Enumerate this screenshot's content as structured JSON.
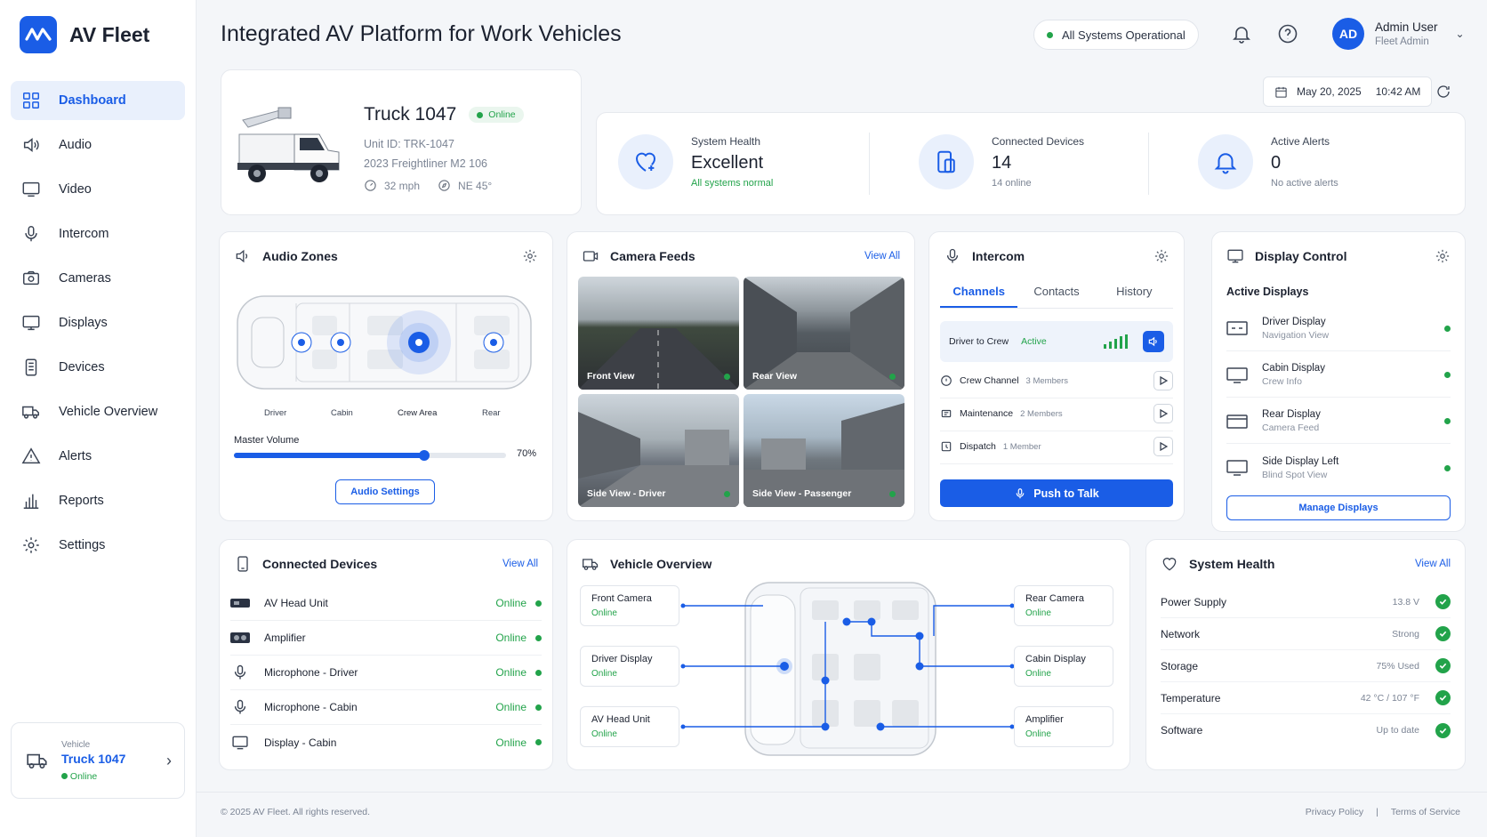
{
  "app": {
    "name": "AV Fleet"
  },
  "header": {
    "title": "Integrated AV Platform for Work Vehicles",
    "status": "All Systems Operational",
    "user": {
      "name": "Admin User",
      "role": "Fleet Admin",
      "initials": "AD"
    }
  },
  "sidebar": {
    "items": [
      {
        "label": "Dashboard"
      },
      {
        "label": "Audio"
      },
      {
        "label": "Video"
      },
      {
        "label": "Intercom"
      },
      {
        "label": "Cameras"
      },
      {
        "label": "Displays"
      },
      {
        "label": "Devices"
      },
      {
        "label": "Vehicle Overview"
      },
      {
        "label": "Alerts"
      },
      {
        "label": "Reports"
      },
      {
        "label": "Settings"
      }
    ],
    "vehicle": {
      "label": "Vehicle",
      "name": "Truck 1047",
      "status": "Online"
    }
  },
  "truck": {
    "name": "Truck 1047",
    "status": "Online",
    "unit_id": "Unit ID: TRK-1047",
    "model": "2023 Freightliner M2 106",
    "speed": "32 mph",
    "heading": "NE 45°"
  },
  "datetime": {
    "date": "May 20, 2025",
    "time": "10:42 AM"
  },
  "stats": [
    {
      "label": "System Health",
      "value": "Excellent",
      "sub": "All systems normal"
    },
    {
      "label": "Connected Devices",
      "value": "14",
      "sub": "14 online"
    },
    {
      "label": "Active Alerts",
      "value": "0",
      "sub": "No active alerts"
    }
  ],
  "audio_zones": {
    "title": "Audio Zones",
    "zones": [
      "Driver",
      "Cabin",
      "Crew Area",
      "Rear"
    ],
    "volume_label": "Master Volume",
    "volume_value": "70%",
    "volume_fraction": 0.7,
    "button": "Audio Settings"
  },
  "camera_feeds": {
    "title": "Camera Feeds",
    "view_all": "View All",
    "cameras": [
      "Front View",
      "Rear View",
      "Side View - Driver",
      "Side View - Passenger"
    ]
  },
  "intercom": {
    "title": "Intercom",
    "tabs": [
      "Channels",
      "Contacts",
      "History"
    ],
    "active_channel": {
      "name": "Driver to Crew",
      "status": "Active"
    },
    "channels": [
      {
        "name": "Crew Channel",
        "members": "3 Members"
      },
      {
        "name": "Maintenance",
        "members": "2 Members"
      },
      {
        "name": "Dispatch",
        "members": "1 Member"
      }
    ],
    "ptt": "Push to Talk"
  },
  "display_control": {
    "title": "Display Control",
    "subtitle": "Active Displays",
    "displays": [
      {
        "name": "Driver Display",
        "sub": "Navigation View"
      },
      {
        "name": "Cabin Display",
        "sub": "Crew Info"
      },
      {
        "name": "Rear Display",
        "sub": "Camera Feed"
      },
      {
        "name": "Side Display Left",
        "sub": "Blind Spot View"
      }
    ],
    "button": "Manage Displays"
  },
  "connected_devices": {
    "title": "Connected Devices",
    "view_all": "View All",
    "devices": [
      {
        "name": "AV Head Unit",
        "status": "Online"
      },
      {
        "name": "Amplifier",
        "status": "Online"
      },
      {
        "name": "Microphone - Driver",
        "status": "Online"
      },
      {
        "name": "Microphone - Cabin",
        "status": "Online"
      },
      {
        "name": "Display - Cabin",
        "status": "Online"
      }
    ]
  },
  "vehicle_overview": {
    "title": "Vehicle Overview",
    "nodes": [
      {
        "name": "Front Camera",
        "status": "Online"
      },
      {
        "name": "Driver Display",
        "status": "Online"
      },
      {
        "name": "AV Head Unit",
        "status": "Online"
      },
      {
        "name": "Rear Camera",
        "status": "Online"
      },
      {
        "name": "Cabin Display",
        "status": "Online"
      },
      {
        "name": "Amplifier",
        "status": "Online"
      }
    ]
  },
  "system_health": {
    "title": "System Health",
    "view_all": "View All",
    "items": [
      {
        "name": "Power Supply",
        "value": "13.8 V"
      },
      {
        "name": "Network",
        "value": "Strong"
      },
      {
        "name": "Storage",
        "value": "75% Used"
      },
      {
        "name": "Temperature",
        "value": "42 °C / 107 °F"
      },
      {
        "name": "Software",
        "value": "Up to date"
      }
    ]
  },
  "footer": {
    "copyright": "© 2025 AV Fleet. All rights reserved.",
    "privacy": "Privacy Policy",
    "separator": "|",
    "terms": "Terms of Service"
  },
  "colors": {
    "accent": "#1a5de6",
    "success": "#22a34a"
  }
}
